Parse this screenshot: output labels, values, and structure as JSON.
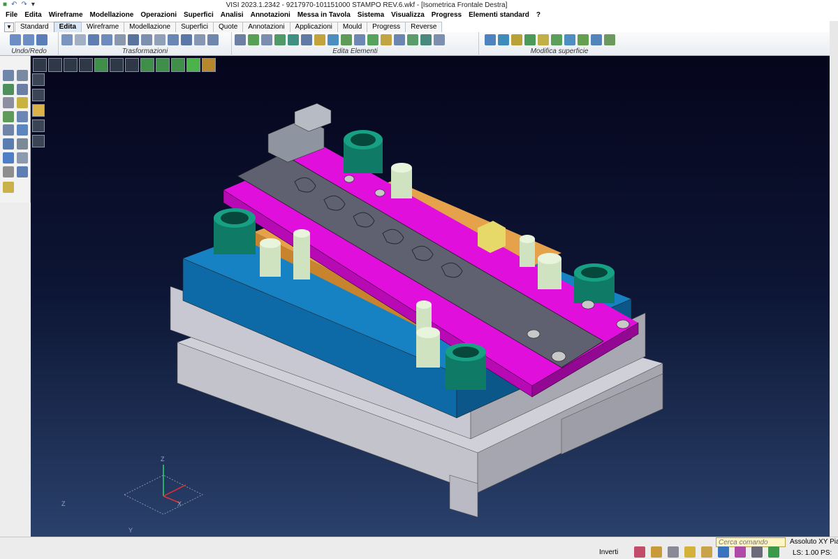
{
  "window": {
    "title": "VISI 2023.1.2342 - 9217970-101151000 STAMPO REV.6.wkf - [Isometrica Frontale Destra]",
    "quick_access": [
      "undo-arrow",
      "redo-arrow",
      "customize-dropdown"
    ]
  },
  "menu": [
    "File",
    "Edita",
    "Wireframe",
    "Modellazione",
    "Operazioni",
    "Superfici",
    "Analisi",
    "Annotazioni",
    "Messa in Tavola",
    "Sistema",
    "Visualizza",
    "Progress",
    "Elementi standard",
    "?"
  ],
  "ribbon": {
    "tabs": [
      "Standard",
      "Edita",
      "Wireframe",
      "Modellazione",
      "Superfici",
      "Quote",
      "Annotazioni",
      "Applicazioni",
      "Mould",
      "Progress",
      "Reverse"
    ],
    "active_tab": "Edita",
    "groups": [
      "Undo/Redo",
      "Trasformazioni",
      "Edita Elementi",
      "Modifica superficie"
    ]
  },
  "status": {
    "invert_label": "Inverti",
    "command_placeholder": "Cerca comando",
    "coord_system": "Assoluto XY Piar",
    "line_scale": "LS: 1.00 PS:"
  },
  "triad": {
    "axes": [
      "Z",
      "X",
      "Y"
    ]
  },
  "colors": {
    "viewport_top": "#05051c",
    "viewport_bottom": "#2a416b",
    "magenta_plate": "#e00fdc",
    "blue_plate": "#0f76b8",
    "grey_base": "#c5c5d0",
    "green_bushing": "#138f79",
    "cream_pillar": "#ddeed0",
    "strip": "#5f6070"
  }
}
